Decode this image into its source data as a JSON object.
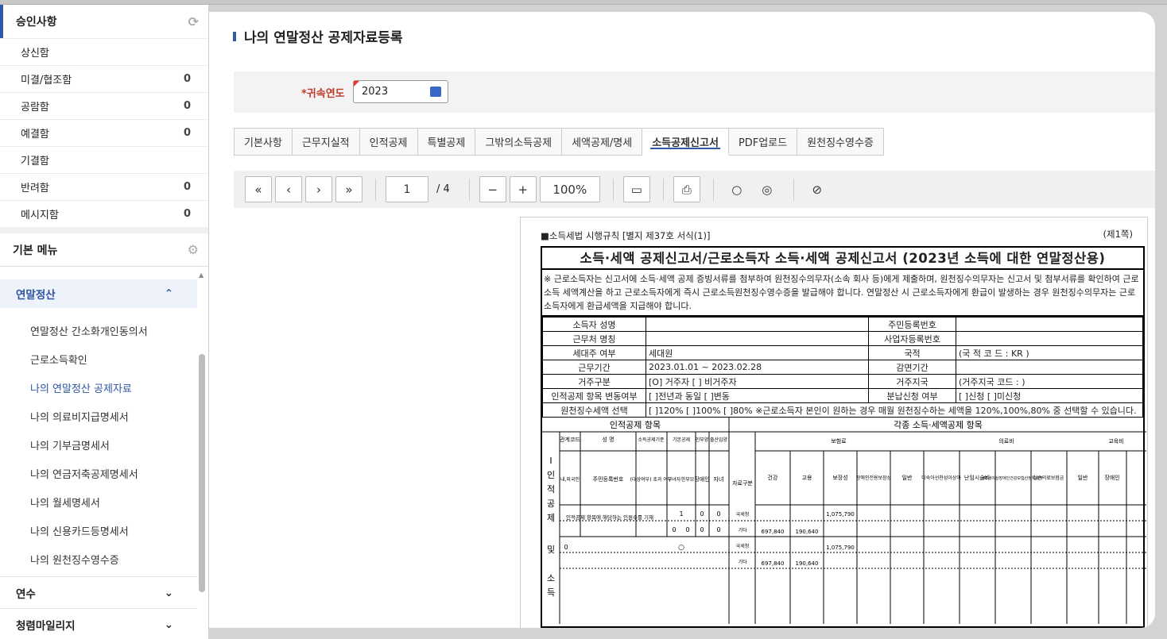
{
  "sidebar": {
    "approval": {
      "title": "승인사항",
      "items": [
        {
          "label": "상신함",
          "count": ""
        },
        {
          "label": "미결/협조함",
          "count": "0"
        },
        {
          "label": "공람함",
          "count": "0"
        },
        {
          "label": "예결함",
          "count": "0"
        },
        {
          "label": "기결함",
          "count": ""
        },
        {
          "label": "반려함",
          "count": "0"
        },
        {
          "label": "메시지함",
          "count": "0"
        }
      ]
    },
    "basic_menu": {
      "title": "기본 메뉴"
    },
    "group": {
      "title": "연말정산",
      "items": [
        "연말정산 간소화개인동의서",
        "근로소득확인",
        "나의 연말정산 공제자료",
        "나의 의료비지급명세서",
        "나의 기부금명세서",
        "나의 연금저축공제명세서",
        "나의 월세명세서",
        "나의 신용카드등명세서",
        "나의 원천징수영수증"
      ]
    },
    "folds": [
      "연수",
      "청렴마일리지"
    ]
  },
  "page": {
    "title": "나의 연말정산 공제자료등록"
  },
  "filter": {
    "label": "*귀속연도",
    "value": "2023"
  },
  "tabs": [
    "기본사항",
    "근무지실적",
    "인적공제",
    "특별공제",
    "그밖의소득공제",
    "세액공제/명세",
    "소득공제신고서",
    "PDF업로드",
    "원천징수영수증"
  ],
  "toolbar": {
    "page": "1",
    "total": "/ 4",
    "zoom": "100%"
  },
  "doc": {
    "ref": "■소득세법 시행규칙 [별지 제37호 서식(1)]",
    "page": "(제1쪽)",
    "title": "소득·세액 공제신고서/근로소득자 소득·세액 공제신고서 (2023년 소득에 대한 연말정산용)",
    "note": "※ 근로소득자는 신고서에 소득·세액 공제 증빙서류를 첨부하여 원천징수의무자(소속 회사 등)에게 제출하며, 원천징수의무자는 신고서 및 첨부서류를 확인하여 근로소득 세액계산을 하고 근로소득자에게 즉시 근로소득원천징수영수증을 발급해야 합니다. 연말정산 시 근로소득자에게 환급이 발생하는 경우 원천징수의무자는 근로소득자에게 환급세액을 지급해야 합니다.",
    "rows": [
      [
        "소득자 성명",
        "",
        "주민등록번호",
        ""
      ],
      [
        "근무처 명칭",
        "",
        "사업자등록번호",
        ""
      ],
      [
        "세대주 여부",
        "세대원",
        "국적",
        "(국 적 코 드 : KR )"
      ],
      [
        "근무기간",
        "2023.01.01 ~ 2023.02.28",
        "감면기간",
        ""
      ],
      [
        "거주구분",
        "[O] 거주자 [ ] 비거주자",
        "거주지국",
        "(거주지국 코드 :      )"
      ],
      [
        "인적공제 항목 변동여부",
        "[ ]전년과 동일 [ ]변동",
        "분납신청 여부",
        "[ ]신청 [ ]미신청"
      ]
    ],
    "withhold": {
      "label": "원천징수세액 선택",
      "text": "[ ]120% [ ]100% [ ]80% ※근로소득자 본인이 원하는 경우 매월 원천징수하는 세액을 120%,100%,80% 중 선택할 수 있습니다."
    },
    "sec_left": "인적공제 항목",
    "sec_right": "각종 소득·세액공제 항목",
    "vert": [
      "I",
      "인",
      "적",
      "공",
      "제",
      "및",
      "소",
      "득"
    ],
    "cols": {
      "rel": "관계코드",
      "name": "성 명",
      "ded": "소득공제기준",
      "basic": "기본공제",
      "other": "인부양",
      "birth": "출산입양",
      "row2": [
        "내,외국인",
        "주민등록번호",
        "(대상여부) 초과 여부",
        "부녀자",
        "한부모",
        "장애인",
        "자녀"
      ],
      "src": "자료구분",
      "ins": "보험료",
      "med": "의료비",
      "edu": "교육비",
      "ins_cols": [
        "건강",
        "고용",
        "보장성",
        "장애인전용보장성"
      ],
      "med_cols": [
        "일반",
        "미숙아선천성이상아",
        "난임시술비",
        "65세이상장애인건강보험산정특례자",
        "실손의료보험금"
      ],
      "edu_cols": [
        "일반",
        "장애인"
      ]
    },
    "data": {
      "hint": "인적공제 항목에 해당하는 인원수를 기재",
      "n1": "1",
      "n0": "0",
      "code0": "0",
      "circle": "○",
      "tax_nts": "국세청",
      "tax_other": "기타",
      "v1": "1,075,790",
      "v2": "697,840",
      "v3": "190,640"
    }
  }
}
